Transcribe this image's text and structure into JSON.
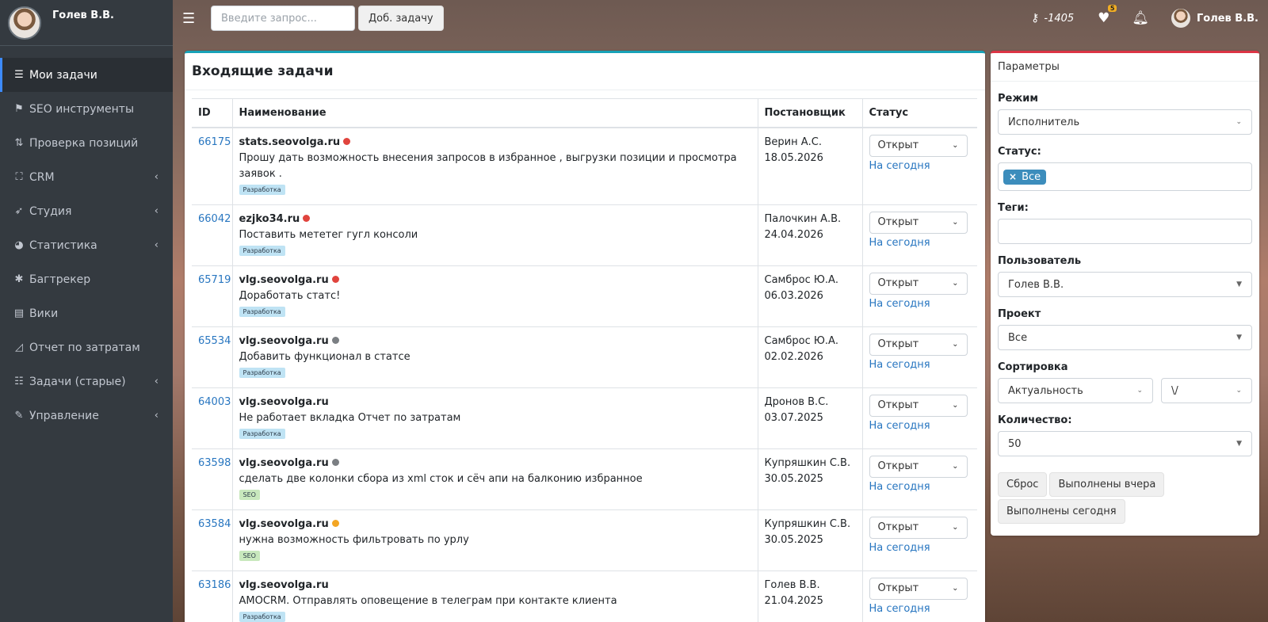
{
  "sidebar": {
    "user_name": "Голев В.В.",
    "items": [
      {
        "label": "Мои задачи",
        "icon": "list-icon",
        "glyph": "☰",
        "active": true,
        "chevron": false
      },
      {
        "label": "SEO инструменты",
        "icon": "tag-icon",
        "glyph": "⚑",
        "active": false,
        "chevron": false
      },
      {
        "label": "Проверка позиций",
        "icon": "sort-icon",
        "glyph": "⇅",
        "active": false,
        "chevron": false
      },
      {
        "label": "CRM",
        "icon": "sitemap-icon",
        "glyph": "⛶",
        "active": false,
        "chevron": true
      },
      {
        "label": "Студия",
        "icon": "rocket-icon",
        "glyph": "➶",
        "active": false,
        "chevron": true
      },
      {
        "label": "Статистика",
        "icon": "pie-chart-icon",
        "glyph": "◕",
        "active": false,
        "chevron": true
      },
      {
        "label": "Багтрекер",
        "icon": "bug-icon",
        "glyph": "✱",
        "active": false,
        "chevron": false
      },
      {
        "label": "Вики",
        "icon": "book-icon",
        "glyph": "▤",
        "active": false,
        "chevron": false
      },
      {
        "label": "Отчет по затратам",
        "icon": "area-chart-icon",
        "glyph": "◿",
        "active": false,
        "chevron": false
      },
      {
        "label": "Задачи (старые)",
        "icon": "tasks-icon",
        "glyph": "☷",
        "active": false,
        "chevron": true
      },
      {
        "label": "Управление",
        "icon": "wrench-icon",
        "glyph": "✎",
        "active": false,
        "chevron": true
      }
    ]
  },
  "topbar": {
    "search_placeholder": "Введите запрос...",
    "add_task_label": "Доб. задачу",
    "balance": "-1405",
    "heartbeat_badge": "5",
    "user_name": "Голев В.В."
  },
  "main": {
    "title": "Входящие задачи",
    "columns": {
      "id": "ID",
      "name": "Наименование",
      "author": "Постановщик",
      "status": "Статус"
    },
    "status_option": "Открыт",
    "today_link": "На сегодня",
    "rows": [
      {
        "id": "66175",
        "domain": "stats.seovolga.ru",
        "dot": "red",
        "text": "Прошу дать возможность внесения запросов в избранное , выгрузки позиции и просмотра заявок .",
        "tag": "Разработка",
        "tag_type": "dev",
        "author": "Верин А.С.",
        "date": "18.05.2026"
      },
      {
        "id": "66042",
        "domain": "ezjko34.ru",
        "dot": "red",
        "text": "Поставить мететег гугл консоли",
        "tag": "Разработка",
        "tag_type": "dev",
        "author": "Палочкин А.В.",
        "date": "24.04.2026"
      },
      {
        "id": "65719",
        "domain": "vlg.seovolga.ru",
        "dot": "red",
        "text": "Доработать статс!",
        "tag": "Разработка",
        "tag_type": "dev",
        "author": "Самброс Ю.А.",
        "date": "06.03.2026"
      },
      {
        "id": "65534",
        "domain": "vlg.seovolga.ru",
        "dot": "gray",
        "text": "Добавить функционал в статсе",
        "tag": "Разработка",
        "tag_type": "dev",
        "author": "Самброс Ю.А.",
        "date": "02.02.2026"
      },
      {
        "id": "64003",
        "domain": "vlg.seovolga.ru",
        "dot": "",
        "text": "Не работает вкладка Отчет по затратам",
        "tag": "Разработка",
        "tag_type": "dev",
        "author": "Дронов В.С.",
        "date": "03.07.2025"
      },
      {
        "id": "63598",
        "domain": "vlg.seovolga.ru",
        "dot": "gray",
        "text": "сделать две колонки сбора из xml сток и сёч апи на балконию избранное",
        "tag": "SEO",
        "tag_type": "seo",
        "author": "Купряшкин С.В.",
        "date": "30.05.2025"
      },
      {
        "id": "63584",
        "domain": "vlg.seovolga.ru",
        "dot": "orange",
        "text": "нужна возможность фильтровать по урлу",
        "tag": "SEO",
        "tag_type": "seo",
        "author": "Купряшкин С.В.",
        "date": "30.05.2025"
      },
      {
        "id": "63186",
        "domain": "vlg.seovolga.ru",
        "dot": "",
        "text": "AMOCRM. Отправлять оповещение в телеграм при контакте клиента",
        "tag": "Разработка",
        "tag_type": "dev",
        "author": "Голев В.В.",
        "date": "21.04.2025"
      }
    ]
  },
  "params": {
    "title": "Параметры",
    "mode_label": "Режим",
    "mode_value": "Исполнитель",
    "status_label": "Статус:",
    "status_chip": "Все",
    "tags_label": "Теги:",
    "user_label": "Пользователь",
    "user_value": "Голев В.В.",
    "project_label": "Проект",
    "project_value": "Все",
    "sort_label": "Сортировка",
    "sort_value": "Актуальность",
    "sort_dir": "\\/",
    "count_label": "Количество:",
    "count_value": "50",
    "reset_label": "Сброс",
    "yesterday_label": "Выполнены вчера",
    "today_label": "Выполнены сегодня"
  },
  "colors": {
    "accent": "#17a2b8",
    "params_accent": "#dc3545",
    "link": "#2876c0",
    "chip": "#3c8dbc",
    "sidebar": "#343a40"
  }
}
